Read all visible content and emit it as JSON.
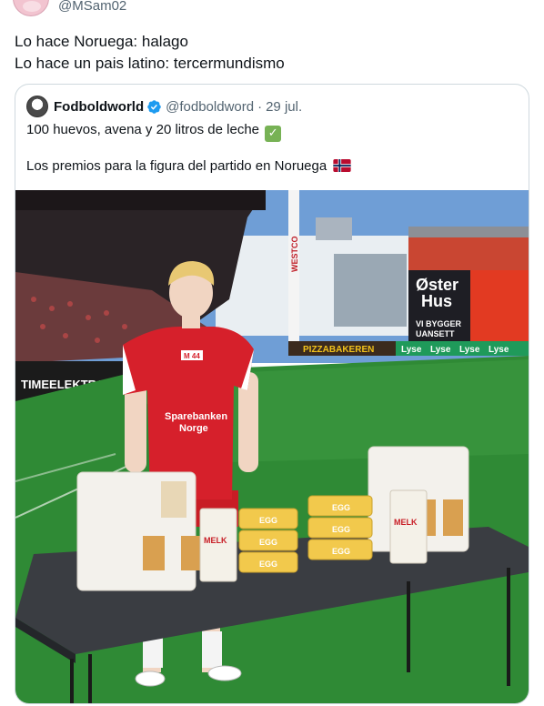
{
  "tweet": {
    "handle": "@MSam02",
    "lines": [
      "Lo hace Noruega: halago",
      "Lo hace un pais latino: tercermundismo"
    ]
  },
  "quote": {
    "name": "Fodboldworld",
    "handle": "@fodboldword",
    "separator": "·",
    "date": "29 jul.",
    "line1": "100 huevos, avena y 20 litros de leche",
    "line2": "Los premios para la figura del partido en Noruega"
  },
  "photo": {
    "signs": {
      "westcon": "WESTCO",
      "oster_hus_1": "Øster",
      "oster_hus_2": "Hus",
      "vi_bygger_1": "VI BYGGER",
      "vi_bygger_2": "UANSETT",
      "lyse": "Lyse",
      "timeelektro": "TIMEELEKTRO",
      "pizzabakeren": "PIZZABAKEREN",
      "jersey_sponsor_1": "Sparebanken",
      "jersey_sponsor_2": "Norge",
      "jersey_badge": "M 44",
      "egg": "EGG",
      "melk": "MELK"
    }
  },
  "colors": {
    "verified_blue": "#1d9bf0",
    "text": "#0f1419",
    "muted": "#536471",
    "border": "#cfd9de",
    "grass": "#2f8a35",
    "jersey_red": "#d6202b"
  }
}
